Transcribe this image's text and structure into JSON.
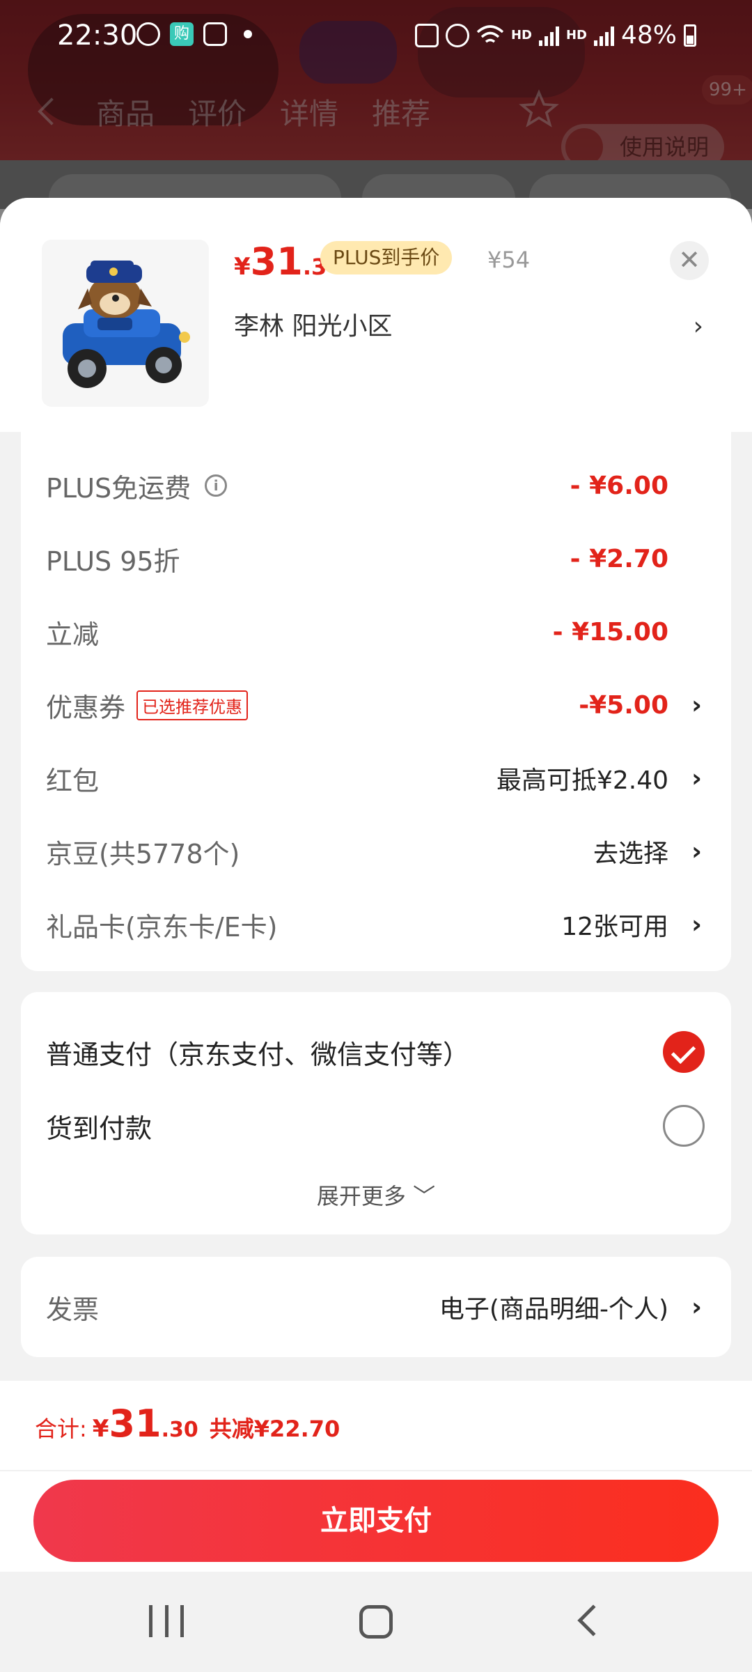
{
  "status_bar": {
    "time": "22:30",
    "app_icon_label": "购",
    "battery": "48%"
  },
  "background_page": {
    "tabs": [
      "商品",
      "评价",
      "详情",
      "推荐"
    ],
    "badge": "99+",
    "manual_label": "使用说明"
  },
  "sheet": {
    "price_yen": "¥",
    "price_int": "31",
    "price_dec": ".3",
    "plus_tag": "PLUS到手价",
    "original_price": "¥54",
    "close_symbol": "✕",
    "address": "李林  阳光小区",
    "chevron": "›"
  },
  "discounts": {
    "rows": [
      {
        "label": "PLUS免运费",
        "value": "- ¥6.00"
      },
      {
        "label": "PLUS 95折",
        "value": "- ¥2.70"
      },
      {
        "label": "立减",
        "value": "- ¥15.00"
      },
      {
        "label": "优惠券",
        "tag": "已选推荐优惠",
        "value": "-¥5.00"
      },
      {
        "label": "红包",
        "value": "最高可抵¥2.40"
      },
      {
        "label": "京豆(共5778个)",
        "value": "去选择"
      },
      {
        "label": "礼品卡(京东卡/E卡)",
        "value": "12张可用"
      }
    ]
  },
  "payment": {
    "options": [
      {
        "label": "普通支付（京东支付、微信支付等）",
        "selected": true
      },
      {
        "label": "货到付款",
        "selected": false
      }
    ],
    "expand_label": "展开更多 ﹀"
  },
  "invoice": {
    "label": "发票",
    "value": "电子(商品明细-个人)"
  },
  "footer": {
    "total_label": "合计:",
    "total_yen": "¥",
    "total_int": "31",
    "total_dec": ".30",
    "saving": "共减¥22.70",
    "pay_button": "立即支付"
  },
  "colors": {
    "accent_red": "#e2231a",
    "plus_tag_bg": "#ffe9b0"
  }
}
